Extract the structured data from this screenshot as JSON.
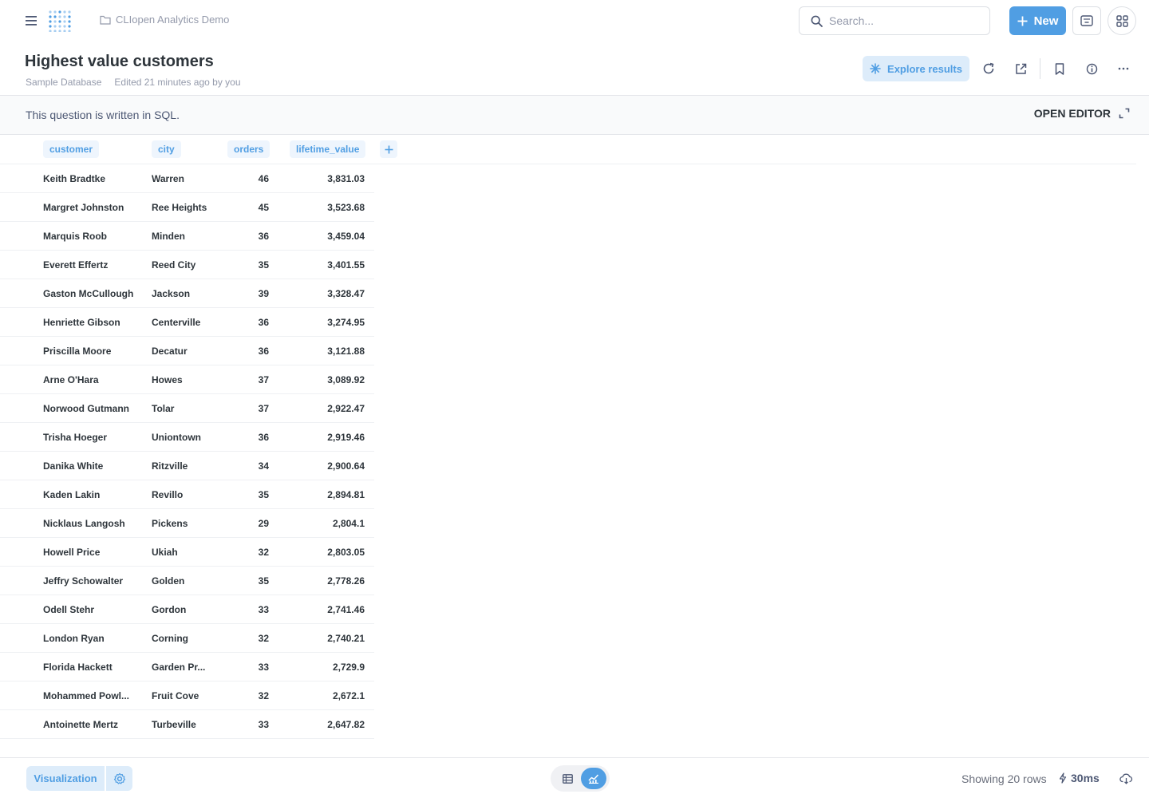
{
  "nav": {
    "collection": "CLIopen Analytics Demo",
    "search_placeholder": "Search...",
    "new_label": "New",
    "icons": [
      "menu-icon",
      "metabase-logo",
      "folder-icon",
      "search-icon",
      "plus-icon",
      "keyboard-icon",
      "grid-icon"
    ]
  },
  "header": {
    "title": "Highest value customers",
    "database": "Sample Database",
    "edited": "Edited 21 minutes ago by you",
    "explore_label": "Explore results"
  },
  "sql_notice": {
    "message": "This question is written in SQL.",
    "open_editor": "OPEN EDITOR"
  },
  "table": {
    "columns": [
      "customer",
      "city",
      "orders",
      "lifetime_value"
    ],
    "rows": [
      [
        "Keith Bradtke",
        "Warren",
        "46",
        "3,831.03"
      ],
      [
        "Margret Johnston",
        "Ree Heights",
        "45",
        "3,523.68"
      ],
      [
        "Marquis Roob",
        "Minden",
        "36",
        "3,459.04"
      ],
      [
        "Everett Effertz",
        "Reed City",
        "35",
        "3,401.55"
      ],
      [
        "Gaston McCullough",
        "Jackson",
        "39",
        "3,328.47"
      ],
      [
        "Henriette Gibson",
        "Centerville",
        "36",
        "3,274.95"
      ],
      [
        "Priscilla Moore",
        "Decatur",
        "36",
        "3,121.88"
      ],
      [
        "Arne O'Hara",
        "Howes",
        "37",
        "3,089.92"
      ],
      [
        "Norwood Gutmann",
        "Tolar",
        "37",
        "2,922.47"
      ],
      [
        "Trisha Hoeger",
        "Uniontown",
        "36",
        "2,919.46"
      ],
      [
        "Danika White",
        "Ritzville",
        "34",
        "2,900.64"
      ],
      [
        "Kaden Lakin",
        "Revillo",
        "35",
        "2,894.81"
      ],
      [
        "Nicklaus Langosh",
        "Pickens",
        "29",
        "2,804.1"
      ],
      [
        "Howell Price",
        "Ukiah",
        "32",
        "2,803.05"
      ],
      [
        "Jeffry Schowalter",
        "Golden",
        "35",
        "2,778.26"
      ],
      [
        "Odell Stehr",
        "Gordon",
        "33",
        "2,741.46"
      ],
      [
        "London Ryan",
        "Corning",
        "32",
        "2,740.21"
      ],
      [
        "Florida Hackett",
        "Garden Pr...",
        "33",
        "2,729.9"
      ],
      [
        "Mohammed Powl...",
        "Fruit Cove",
        "32",
        "2,672.1"
      ],
      [
        "Antoinette Mertz",
        "Turbeville",
        "33",
        "2,647.82"
      ]
    ]
  },
  "footer": {
    "visualization_label": "Visualization",
    "rows_label": "Showing 20 rows",
    "timing": "30ms"
  },
  "colors": {
    "brand": "#509ee3",
    "brand_light": "#ddecfa",
    "text_dark": "#2e353b",
    "text_muted": "#949aab"
  }
}
